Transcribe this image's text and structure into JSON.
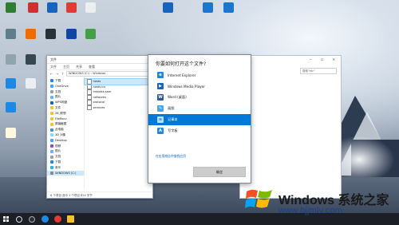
{
  "desktop": {
    "icons": [
      {
        "name": "desktop-icon-1",
        "label": "",
        "color": "#2e7d32"
      },
      {
        "name": "desktop-icon-2",
        "label": "",
        "color": "#d32f2f"
      },
      {
        "name": "desktop-icon-3",
        "label": "",
        "color": "#1565c0"
      },
      {
        "name": "desktop-icon-4",
        "label": "",
        "color": "#e53935"
      },
      {
        "name": "desktop-icon-5",
        "label": "",
        "color": "#607d8b"
      },
      {
        "name": "desktop-icon-6",
        "label": "",
        "color": "#1565c0"
      },
      {
        "name": "desktop-icon-7",
        "label": "",
        "color": "#4caf50"
      }
    ]
  },
  "explorer": {
    "title": "文件",
    "ribbon": [
      "文件",
      "主页",
      "共享",
      "查看"
    ],
    "address": "WINDOWS (C:) › Windows",
    "nav_items": [
      "下载",
      "OneDrive",
      "文档",
      "图片",
      "WPS网盘",
      "文件",
      "26_联想",
      "FileRecv",
      "屏幕截图",
      "此电脑",
      "3D 对象",
      "Desktop",
      "视频",
      "图片",
      "文档",
      "下载",
      "音乐",
      "WINDOWS (C:)"
    ],
    "selected_nav": "WINDOWS (C:)",
    "files": [
      "hosts",
      "hosts.ics",
      "lmhosts.sam",
      "networks",
      "protocol",
      "services"
    ],
    "status": "6 个项目  选中 1 个项目 824 字节"
  },
  "bgwindow": {
    "search_placeholder": "搜索\"etc\""
  },
  "dialog": {
    "title": "你要如何打开这个文件?",
    "apps": [
      {
        "label": "Internet Explorer",
        "icon": "ie-icon",
        "color": "#1e88e5"
      },
      {
        "label": "Windows Media Player",
        "icon": "media-player-icon",
        "color": "#1565c0"
      },
      {
        "label": "Word (桌面)",
        "icon": "word-icon",
        "color": "#2b579a"
      },
      {
        "label": "画图",
        "icon": "paint-icon",
        "color": "#42a5f5"
      },
      {
        "label": "记事本",
        "icon": "notepad-icon",
        "color": "#64b5f6"
      },
      {
        "label": "写字板",
        "icon": "wordpad-icon",
        "color": "#1e88e5"
      }
    ],
    "selected_app": "记事本",
    "store_link": "在应用商店中查找应用",
    "ok_label": "确定"
  },
  "watermark": {
    "brand": "Windows 系统之家",
    "url": "www.bjjmlv.com"
  }
}
